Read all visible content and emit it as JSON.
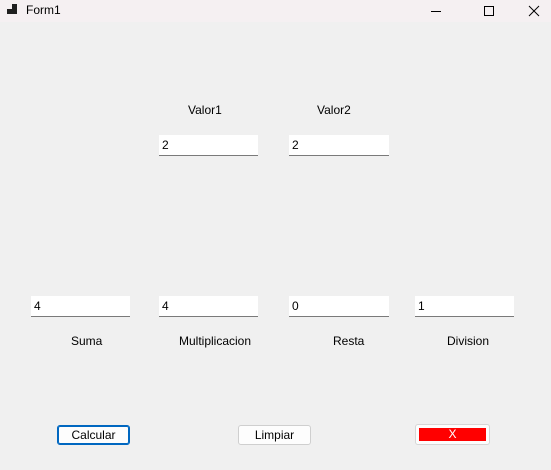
{
  "window": {
    "title": "Form1"
  },
  "labels": {
    "valor1": "Valor1",
    "valor2": "Valor2",
    "suma": "Suma",
    "multiplicacion": "Multiplicacion",
    "resta": "Resta",
    "division": "Division"
  },
  "inputs": {
    "valor1": "2",
    "valor2": "2",
    "suma": "4",
    "multiplicacion": "4",
    "resta": "0",
    "division": "1"
  },
  "buttons": {
    "calcular": "Calcular",
    "limpiar": "Limpiar",
    "x": "X"
  },
  "colors": {
    "x_button_fill": "#ff0000",
    "default_button_border": "#0067c0"
  },
  "icons": {
    "app": "form-app-icon",
    "minimize": "minimize-icon",
    "maximize": "maximize-icon",
    "close": "close-icon"
  }
}
